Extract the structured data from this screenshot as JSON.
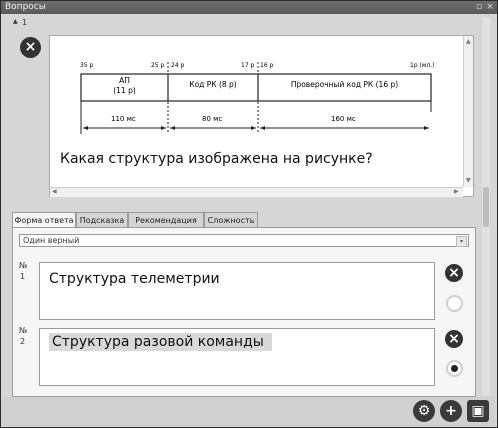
{
  "window": {
    "title": "Вопросы",
    "pin_glyph": "▫",
    "close_glyph": "×"
  },
  "question": {
    "number_label": "1",
    "collapse_glyph": "▲",
    "delete_glyph": "×",
    "text": "Какая структура изображена на рисунке?",
    "diagram": {
      "ticks": [
        "35 р",
        "25 р",
        "24 р",
        "17 р",
        "16 р",
        "1р (мл.)"
      ],
      "blocks": [
        {
          "line1": "АП",
          "line2": "(11 р)"
        },
        {
          "line1": "Код РК (8 р)",
          "line2": ""
        },
        {
          "line1": "Проверочный код РК (16  р)",
          "line2": ""
        }
      ],
      "durations": [
        "110 мс",
        "80 мс",
        "160 мс"
      ]
    },
    "scroll_up": "▲",
    "scroll_down": "▼",
    "scroll_left": "◀",
    "scroll_right": "▶"
  },
  "tabs": [
    {
      "label": "Форма ответа",
      "active": true
    },
    {
      "label": "Подсказка",
      "active": false
    },
    {
      "label": "Рекомендация",
      "active": false
    },
    {
      "label": "Сложность",
      "active": false
    }
  ],
  "answer_type": {
    "value": "Один верный",
    "arrow": "▾"
  },
  "answers": [
    {
      "num_symbol": "№",
      "index": "1",
      "text": "Структура телеметрии",
      "selected": false,
      "delete_glyph": "×"
    },
    {
      "num_symbol": "№",
      "index": "2",
      "text": "Структура разовой команды",
      "selected": true,
      "delete_glyph": "×"
    }
  ],
  "bottom_icons": [
    {
      "name": "settings-icon",
      "glyph": "⚙"
    },
    {
      "name": "add-icon",
      "glyph": "+"
    },
    {
      "name": "save-icon",
      "glyph": "▣"
    }
  ],
  "colors": {
    "titlebar": "#5f5f5f",
    "background": "#d6d6d6",
    "highlight": "#d9d9d9"
  }
}
